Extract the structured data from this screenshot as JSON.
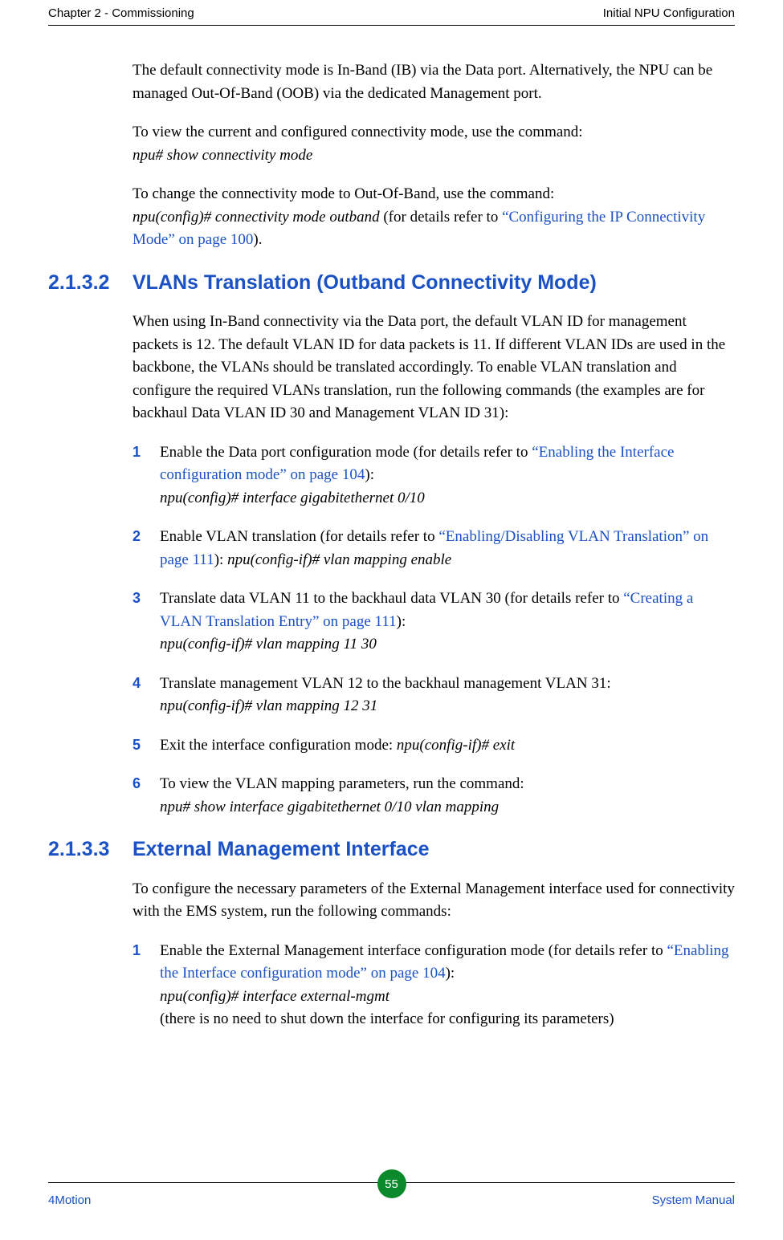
{
  "header": {
    "left": "Chapter 2 - Commissioning",
    "right": "Initial NPU Configuration"
  },
  "intro": {
    "p1": "The default connectivity mode is In-Band (IB) via the Data port. Alternatively, the NPU can be managed Out-Of-Band (OOB) via the dedicated Management port.",
    "p2a": "To view the current and configured connectivity mode, use the command:",
    "p2b": "npu# show connectivity mode",
    "p3a": "To change the connectivity mode to Out-Of-Band, use the command:",
    "p3b": "npu(config)# connectivity mode outband",
    "p3c": " (for details refer to ",
    "p3link": "“Configuring the IP Connectivity Mode” on page 100",
    "p3d": ")."
  },
  "sec1": {
    "num": "2.1.3.2",
    "title": "VLANs Translation (Outband Connectivity Mode)",
    "para": "When using In-Band connectivity via the Data port, the default VLAN ID for management packets is 12. The default VLAN ID for data packets is 11. If different VLAN IDs are used in the backbone, the VLANs should be translated accordingly. To enable VLAN translation and configure the required VLANs translation, run the following commands (the examples are for backhaul Data VLAN ID 30 and Management VLAN ID 31):",
    "steps": {
      "s1": {
        "n": "1",
        "a": "Enable the Data port configuration mode (for details refer to ",
        "link": "“Enabling the Interface configuration mode” on page 104",
        "b": "):",
        "cmd": "npu(config)# interface gigabitethernet 0/10"
      },
      "s2": {
        "n": "2",
        "a": "Enable VLAN translation (for details refer to ",
        "link": "“Enabling/Disabling VLAN Translation” on page 111",
        "b": "): ",
        "cmd": "npu(config-if)# vlan mapping enable"
      },
      "s3": {
        "n": "3",
        "a": "Translate data VLAN 11 to the backhaul data VLAN 30 (for details refer to ",
        "link": "“Creating a VLAN Translation Entry” on page 111",
        "b": "):",
        "cmd": "npu(config-if)# vlan mapping 11 30"
      },
      "s4": {
        "n": "4",
        "a": "Translate management VLAN 12 to the backhaul management VLAN 31:",
        "cmd": "npu(config-if)# vlan mapping 12 31"
      },
      "s5": {
        "n": "5",
        "a": "Exit the interface configuration mode: ",
        "cmd": "npu(config-if)# exit"
      },
      "s6": {
        "n": "6",
        "a": "To view the VLAN mapping parameters, run the command:",
        "cmd": "npu# show interface gigabitethernet 0/10 vlan mapping"
      }
    }
  },
  "sec2": {
    "num": "2.1.3.3",
    "title": "External Management Interface",
    "para": "To configure the necessary parameters of the External Management interface used for connectivity with the EMS system, run the following commands:",
    "steps": {
      "s1": {
        "n": "1",
        "a": "Enable the External Management interface configuration mode (for details refer to ",
        "link": "“Enabling the Interface configuration mode” on page 104",
        "b": "):",
        "cmd": "npu(config)# interface external-mgmt",
        "tail": "(there is no need to shut down the interface for configuring its parameters)"
      }
    }
  },
  "footer": {
    "left": "4Motion",
    "page": "55",
    "right": "System Manual"
  }
}
